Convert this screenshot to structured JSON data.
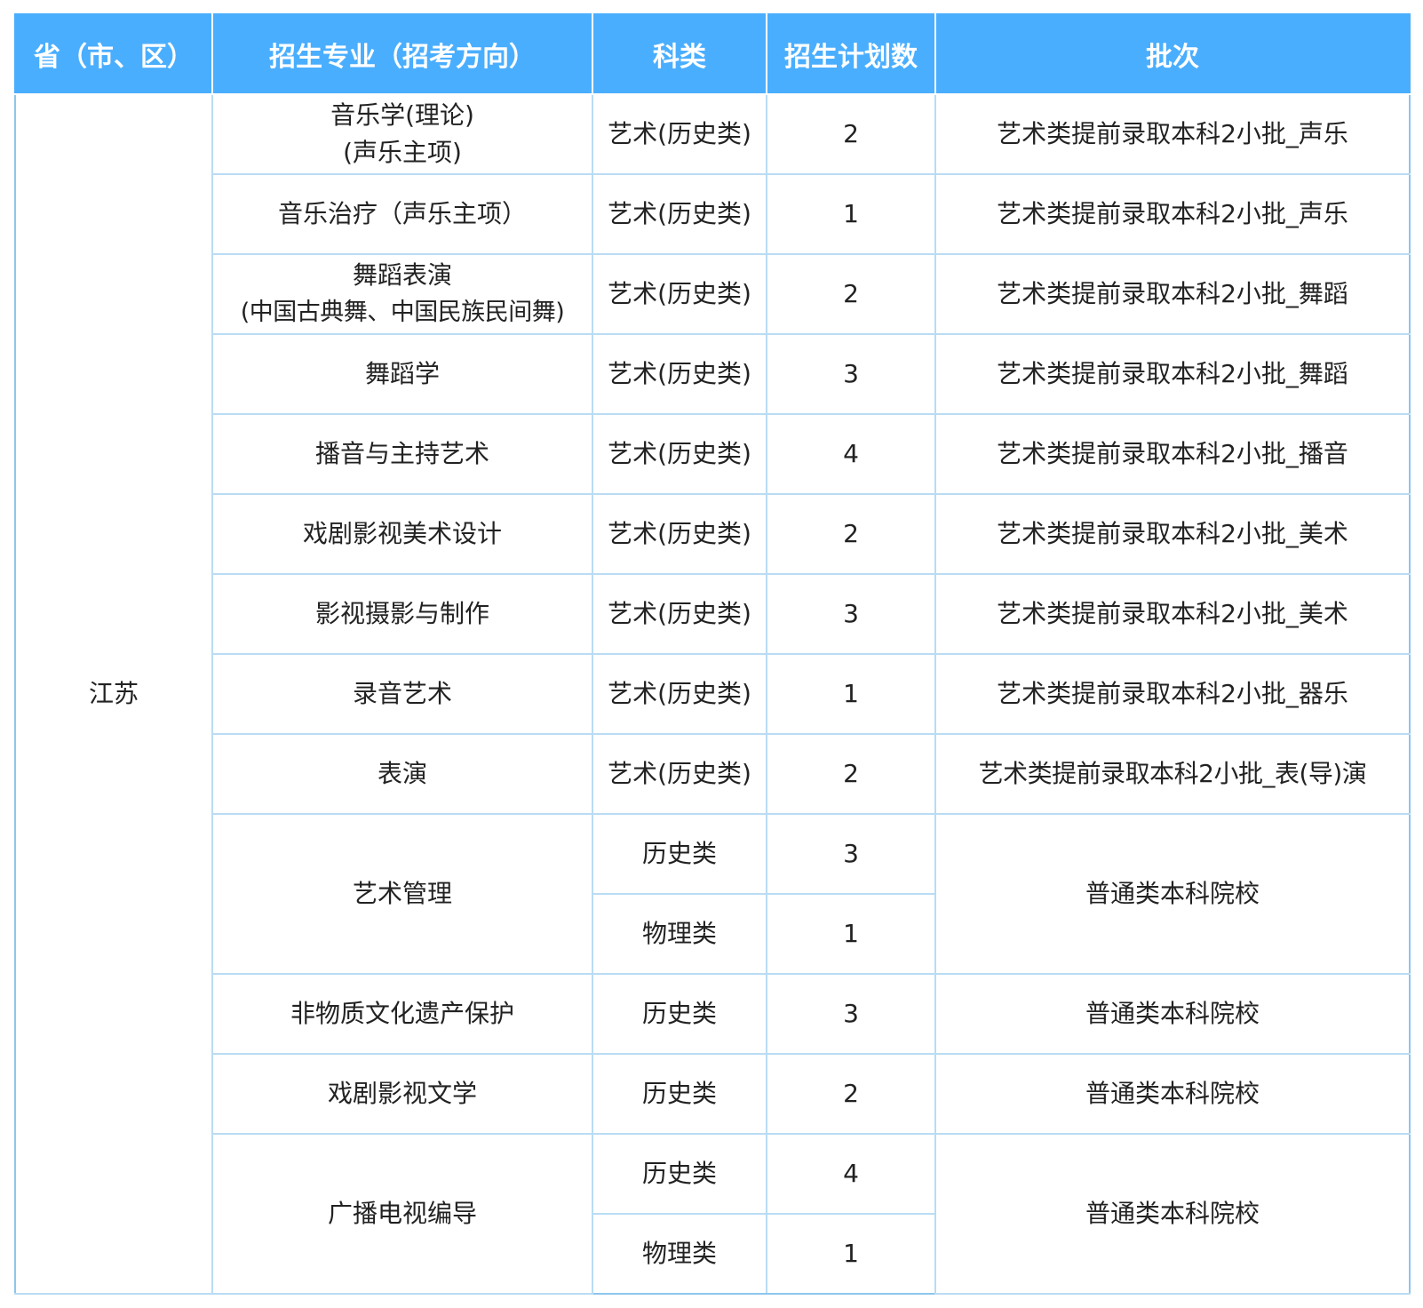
{
  "headers": {
    "province": "省（市、区）",
    "major": "招生专业（招考方向）",
    "subject": "科类",
    "plan": "招生计划数",
    "batch": "批次"
  },
  "province": "江苏",
  "rows": [
    {
      "major_line1": "音乐学(理论)",
      "major_line2": "(声乐主项)",
      "subject": "艺术(历史类)",
      "plan": "2",
      "batch": "艺术类提前录取本科2小批_声乐"
    },
    {
      "major": "音乐治疗（声乐主项）",
      "subject": "艺术(历史类)",
      "plan": "1",
      "batch": "艺术类提前录取本科2小批_声乐"
    },
    {
      "major_line1": "舞蹈表演",
      "major_line2": "(中国古典舞、中国民族民间舞)",
      "subject": "艺术(历史类)",
      "plan": "2",
      "batch": "艺术类提前录取本科2小批_舞蹈"
    },
    {
      "major": "舞蹈学",
      "subject": "艺术(历史类)",
      "plan": "3",
      "batch": "艺术类提前录取本科2小批_舞蹈"
    },
    {
      "major": "播音与主持艺术",
      "subject": "艺术(历史类)",
      "plan": "4",
      "batch": "艺术类提前录取本科2小批_播音"
    },
    {
      "major": "戏剧影视美术设计",
      "subject": "艺术(历史类)",
      "plan": "2",
      "batch": "艺术类提前录取本科2小批_美术"
    },
    {
      "major": "影视摄影与制作",
      "subject": "艺术(历史类)",
      "plan": "3",
      "batch": "艺术类提前录取本科2小批_美术"
    },
    {
      "major": "录音艺术",
      "subject": "艺术(历史类)",
      "plan": "1",
      "batch": "艺术类提前录取本科2小批_器乐"
    },
    {
      "major": "表演",
      "subject": "艺术(历史类)",
      "plan": "2",
      "batch": "艺术类提前录取本科2小批_表(导)演"
    },
    {
      "major": "艺术管理",
      "subject": "历史类",
      "plan": "3",
      "batch": "普通类本科院校"
    },
    {
      "subject": "物理类",
      "plan": "1"
    },
    {
      "major": "非物质文化遗产保护",
      "subject": "历史类",
      "plan": "3",
      "batch": "普通类本科院校"
    },
    {
      "major": "戏剧影视文学",
      "subject": "历史类",
      "plan": "2",
      "batch": "普通类本科院校"
    },
    {
      "major": "广播电视编导",
      "subject": "历史类",
      "plan": "4",
      "batch": "普通类本科院校"
    },
    {
      "subject": "物理类",
      "plan": "1"
    }
  ]
}
